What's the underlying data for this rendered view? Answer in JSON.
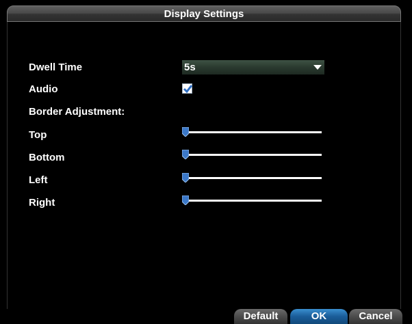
{
  "window": {
    "title": "Display Settings"
  },
  "fields": {
    "dwell_time": {
      "label": "Dwell Time",
      "value": "5s"
    },
    "audio": {
      "label": "Audio",
      "checked": true
    },
    "border_adjustment": {
      "label": "Border Adjustment:"
    },
    "sliders": [
      {
        "label": "Top",
        "value": 0
      },
      {
        "label": "Bottom",
        "value": 0
      },
      {
        "label": "Left",
        "value": 0
      },
      {
        "label": "Right",
        "value": 0
      }
    ]
  },
  "buttons": {
    "default": "Default",
    "ok": "OK",
    "cancel": "Cancel"
  },
  "colors": {
    "background": "#000000",
    "accent": "#1a5d99",
    "thumb": "#3b78c8"
  },
  "icons": {
    "dropdown": "chevron-down-icon",
    "checkbox_mark": "checkmark-icon",
    "slider_thumb": "slider-thumb-icon"
  }
}
